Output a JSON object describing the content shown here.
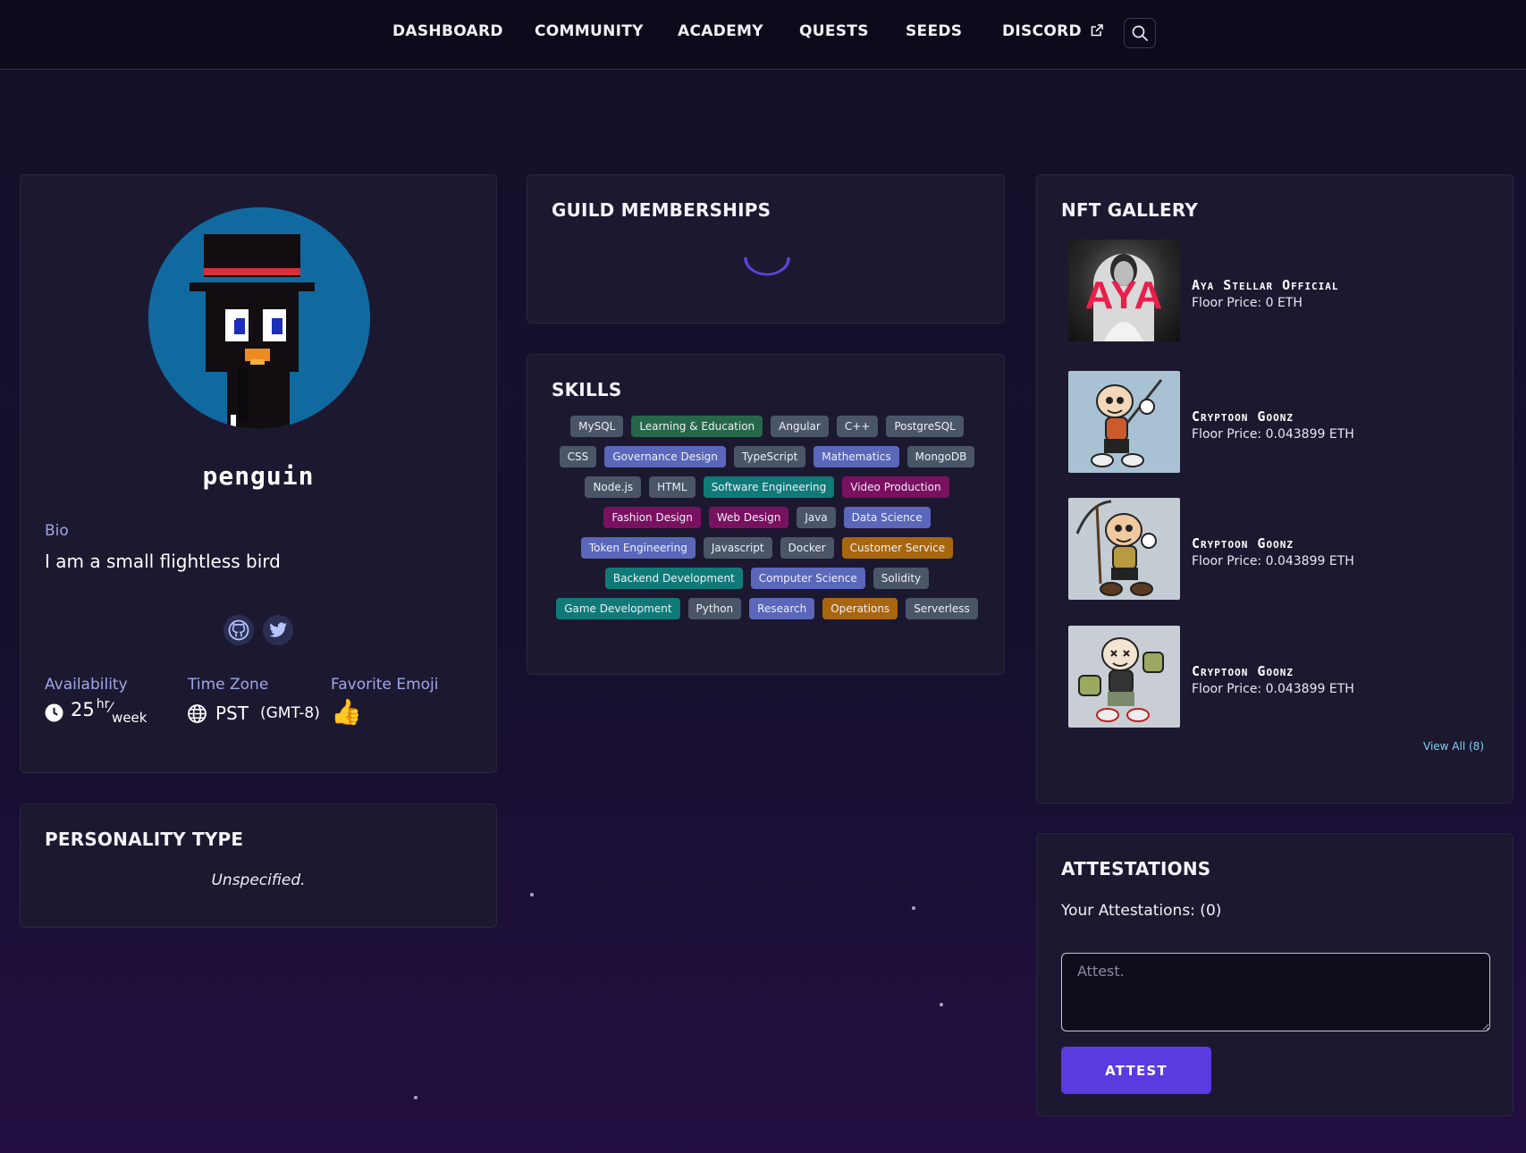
{
  "nav": {
    "items": [
      "DASHBOARD",
      "COMMUNITY",
      "ACADEMY",
      "QUESTS",
      "SEEDS",
      "DISCORD"
    ]
  },
  "profile": {
    "username": "penguin",
    "bio_label": "Bio",
    "bio": "I am a small flightless bird",
    "availability_label": "Availability",
    "availability_hours": "25",
    "availability_unit_top": "hr",
    "availability_unit_bottom": "week",
    "timezone_label": "Time Zone",
    "timezone": "PST",
    "timezone_offset": "(GMT-8)",
    "emoji_label": "Favorite Emoji",
    "emoji": "👍"
  },
  "personality": {
    "title": "PERSONALITY TYPE",
    "value": "Unspecified."
  },
  "guild": {
    "title": "GUILD MEMBERSHIPS"
  },
  "skills": {
    "title": "SKILLS",
    "items": [
      {
        "label": "MySQL",
        "color": "#4a5568"
      },
      {
        "label": "Learning & Education",
        "color": "#276749"
      },
      {
        "label": "Angular",
        "color": "#4a5568"
      },
      {
        "label": "C++",
        "color": "#4a5568"
      },
      {
        "label": "PostgreSQL",
        "color": "#4a5568"
      },
      {
        "label": "CSS",
        "color": "#4a5568"
      },
      {
        "label": "Governance Design",
        "color": "#5a67ba"
      },
      {
        "label": "TypeScript",
        "color": "#4a5568"
      },
      {
        "label": "Mathematics",
        "color": "#5a67ba"
      },
      {
        "label": "MongoDB",
        "color": "#4a5568"
      },
      {
        "label": "Node.js",
        "color": "#4a5568"
      },
      {
        "label": "HTML",
        "color": "#4a5568"
      },
      {
        "label": "Software Engineering",
        "color": "#0f7a78"
      },
      {
        "label": "Video Production",
        "color": "#7a1060"
      },
      {
        "label": "Fashion Design",
        "color": "#7a1060"
      },
      {
        "label": "Web Design",
        "color": "#7a1060"
      },
      {
        "label": "Java",
        "color": "#4a5568"
      },
      {
        "label": "Data Science",
        "color": "#5a67ba"
      },
      {
        "label": "Token Engineering",
        "color": "#5a67ba"
      },
      {
        "label": "Javascript",
        "color": "#4a5568"
      },
      {
        "label": "Docker",
        "color": "#4a5568"
      },
      {
        "label": "Customer Service",
        "color": "#a8660e"
      },
      {
        "label": "Backend Development",
        "color": "#0f7a78"
      },
      {
        "label": "Computer Science",
        "color": "#5a67ba"
      },
      {
        "label": "Solidity",
        "color": "#4a5568"
      },
      {
        "label": "Game Development",
        "color": "#0f7a78"
      },
      {
        "label": "Python",
        "color": "#4a5568"
      },
      {
        "label": "Research",
        "color": "#5a67ba"
      },
      {
        "label": "Operations",
        "color": "#a8660e"
      },
      {
        "label": "Serverless",
        "color": "#4a5568"
      }
    ]
  },
  "nft": {
    "title": "NFT GALLERY",
    "items": [
      {
        "name": "Aya Stellar Official",
        "price": "Floor Price: 0 ETH",
        "thumb_text": "AYA"
      },
      {
        "name": "Cryptoon Goonz",
        "price": "Floor Price: 0.043899 ETH"
      },
      {
        "name": "Cryptoon Goonz",
        "price": "Floor Price: 0.043899 ETH"
      },
      {
        "name": "Cryptoon Goonz",
        "price": "Floor Price: 0.043899 ETH"
      }
    ],
    "view_all": "View All (8)"
  },
  "attestations": {
    "title": "ATTESTATIONS",
    "count_text": "Your Attestations: (0)",
    "placeholder": "Attest.",
    "button": "ATTEST"
  },
  "colors": {
    "accent": "#5b3ae0",
    "label": "#9ea6e8",
    "spinner": "#5a46d8"
  }
}
